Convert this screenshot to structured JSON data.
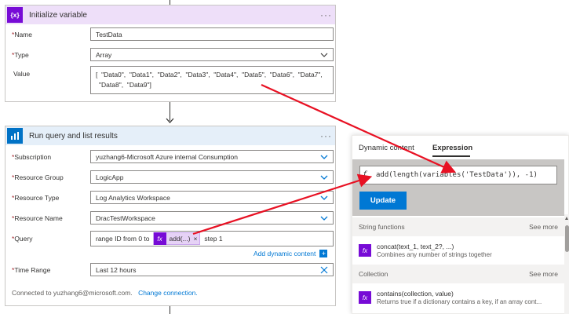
{
  "init_card": {
    "title": "Initialize variable",
    "icon": "{x}",
    "more": "···",
    "name_label": "Name",
    "name_value": "TestData",
    "type_label": "Type",
    "type_value": "Array",
    "value_label": "Value",
    "value_line1": "[  \"Data0\",  \"Data1\",  \"Data2\",  \"Data3\",  \"Data4\",  \"Data5\",  \"Data6\",  \"Data7\",",
    "value_line2": "\"Data8\",  \"Data9\"]"
  },
  "query_card": {
    "title": "Run query and list results",
    "more": "···",
    "subscription_label": "Subscription",
    "subscription_value": "yuzhang6-Microsoft Azure internal Consumption",
    "resource_group_label": "Resource Group",
    "resource_group_value": "LogicApp",
    "resource_type_label": "Resource Type",
    "resource_type_value": "Log Analytics Workspace",
    "resource_name_label": "Resource Name",
    "resource_name_value": "DracTestWorkspace",
    "query_label": "Query",
    "query_prefix": "range ID from 0 to",
    "token_label": "add(...)",
    "token_remove": "×",
    "query_suffix": "step 1",
    "add_dynamic": "Add dynamic content",
    "time_range_label": "Time Range",
    "time_range_value": "Last 12 hours",
    "connected_text": "Connected to yuzhang6@microsoft.com.",
    "change_connection": "Change connection."
  },
  "panel": {
    "tab_dynamic": "Dynamic content",
    "tab_expression": "Expression",
    "expression": "add(length(variables('TestData')), -1)",
    "update": "Update",
    "section1": "String functions",
    "section1_more": "See more",
    "fn1_name": "concat(text_1, text_2?, ...)",
    "fn1_desc": "Combines any number of strings together",
    "section2": "Collection",
    "section2_more": "See more",
    "fn2_name": "contains(collection, value)",
    "fn2_desc": "Returns true if a dictionary contains a key, if an array cont...",
    "fx_glyph": "fx"
  },
  "colors": {
    "init_accent": "#770bd6",
    "init_head_bg": "#eedff9",
    "query_accent": "#0072c6",
    "query_head_bg": "#e5eff9",
    "arrow": "#e81123",
    "button": "#0078d4"
  }
}
